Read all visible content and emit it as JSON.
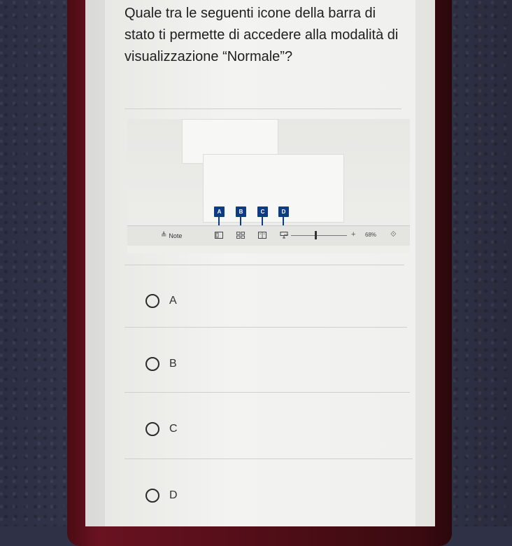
{
  "question": {
    "text": "Quale tra le seguenti icone della barra di stato ti permette di accedere alla modalità di visualizzazione “Normale”?"
  },
  "figure": {
    "callouts": [
      "A",
      "B",
      "C",
      "D"
    ],
    "statusbar": {
      "note_label": "Note",
      "zoom_minus": "–",
      "zoom_plus": "+",
      "zoom_percent": "68%",
      "icons": [
        "normal-view-icon",
        "slide-sorter-icon",
        "reading-view-icon",
        "slideshow-icon",
        "fit-to-window-icon"
      ]
    }
  },
  "options": [
    {
      "label": "A"
    },
    {
      "label": "B"
    },
    {
      "label": "C"
    },
    {
      "label": "D"
    }
  ],
  "colors": {
    "callout": "#0e3b86",
    "card": "#f0f0ee",
    "frame": "#5a0f1a"
  }
}
